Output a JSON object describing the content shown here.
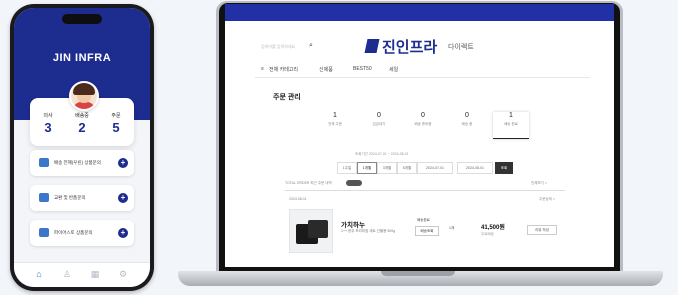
{
  "phone": {
    "brand": "JIN INFRA",
    "stats": [
      {
        "label": "의사",
        "value": "3"
      },
      {
        "label": "배송중",
        "value": "2"
      },
      {
        "label": "주문",
        "value": "5"
      }
    ],
    "menu": [
      {
        "label": "배송 전혜(우린) 상품문의",
        "icon": "truck-icon"
      },
      {
        "label": "교환 및 반품문의",
        "icon": "box-icon"
      },
      {
        "label": "파이어스토 상품문의",
        "icon": "chat-icon"
      }
    ],
    "tabs": [
      {
        "icon": "home-icon",
        "glyph": "⌂"
      },
      {
        "icon": "user-icon",
        "glyph": "♙"
      },
      {
        "icon": "grid-icon",
        "glyph": "▦"
      },
      {
        "icon": "gear-icon",
        "glyph": "⚙"
      }
    ]
  },
  "web": {
    "search_placeholder": "검색어를 입력하세요",
    "brand": "진인프라",
    "brand_sub": "다이렉트",
    "nav": [
      "전체 카테고리",
      "신제품",
      "BEST50",
      "세일"
    ],
    "order_title": "주문 관리",
    "status_boxes": [
      {
        "count": "1",
        "label": "전체 주문"
      },
      {
        "count": "0",
        "label": "입금대기"
      },
      {
        "count": "0",
        "label": "배송 준비중"
      },
      {
        "count": "0",
        "label": "배송 중"
      },
      {
        "count": "1",
        "label": "배송 완료"
      }
    ],
    "date_hint": "조회기간 2024-07-01 ~ 2024-08-01",
    "filters": [
      "1주일",
      "1개월",
      "3개월",
      "6개월",
      "2024-07-01",
      "2024-08-01",
      "조회"
    ],
    "list_header": "TOTAL ORDER 최근 주문 내역",
    "list_right": "전체보기 >",
    "order_sub": "2024.08.01",
    "order_sub_right": "주문상세 >",
    "product": {
      "name": "가치하누",
      "desc": "1++ 한우 프리미엄 세트 선물용 500g",
      "ship_status": "배송완료",
      "ship_btn": "배송조회",
      "qty": "1개",
      "price": "41,500원",
      "price_sub": "무료배송",
      "review_btn": "리뷰 작성"
    }
  }
}
